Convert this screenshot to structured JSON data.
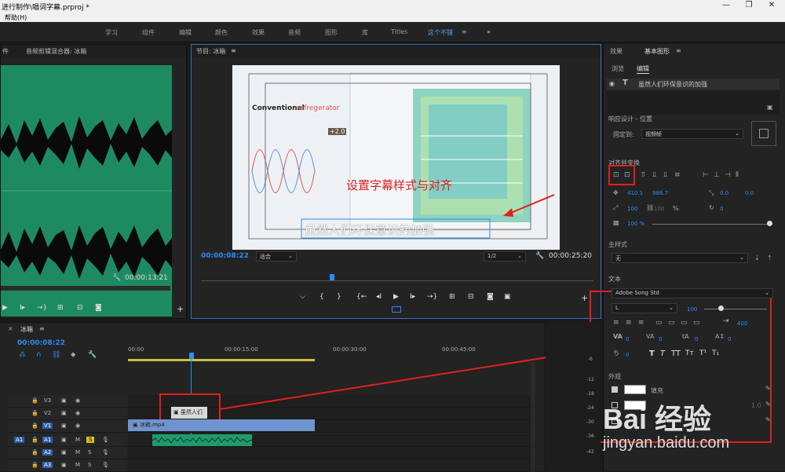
{
  "window": {
    "title": "进行制作\\唱词字幕.prproj *",
    "menu_help": "帮助(H)"
  },
  "workspaces": [
    {
      "label": "学习"
    },
    {
      "label": "组件"
    },
    {
      "label": "编辑"
    },
    {
      "label": "颜色"
    },
    {
      "label": "效果"
    },
    {
      "label": "音频"
    },
    {
      "label": "图形"
    },
    {
      "label": "库"
    },
    {
      "label": "Titles"
    },
    {
      "label": "这个不错"
    }
  ],
  "source_panel": {
    "tab_left": "件",
    "tab": "音频剪辑混合器: 冰箱",
    "timecode": "00:00:13:21"
  },
  "program": {
    "title": "节目: 冰箱",
    "timecode_current": "00:00:08:22",
    "timecode_duration": "00:00:25:20",
    "zoom": "适合",
    "resolution": "1/2",
    "video_heading_bold": "Conventional",
    "video_heading_light": "refregerator",
    "video_badge": "+2.0",
    "annotation": "设置字幕样式与对齐",
    "subtitle": "虽然人们环保意识的加强"
  },
  "right_panel": {
    "tab_effects": "效果",
    "tab_graphics": "基本图形",
    "subtab_browse": "浏览",
    "subtab_edit": "编辑",
    "layer_text": "虽然人们环保意识的加强",
    "responsive_label": "响应设计 - 位置",
    "pin_label": "固定到:",
    "pin_value": "视频帧",
    "align_label": "对齐并变换",
    "pos_x": "410.1",
    "pos_y": "988.7",
    "anchor_x": "0.0",
    "anchor_y": "0.0",
    "scale": "100",
    "scale2": "100",
    "scale_unit": "%",
    "rotation": "0",
    "opacity": "100 %",
    "master_style_label": "主样式",
    "master_style_value": "无",
    "text_label": "文本",
    "font_value": "Adobe Song Std",
    "font_style": "L",
    "font_size": "100",
    "tracking_right": "400",
    "kerning": "0",
    "tracking": "0",
    "leading": "0",
    "baseline": "0",
    "tsume": "0",
    "appearance_label": "外观",
    "fill_label": "填充",
    "stroke_value": "1.0"
  },
  "timeline": {
    "title": "冰箱",
    "timecode": "00:00:08:22",
    "ruler": [
      "00:00",
      "00:00:15:00",
      "00:00:30:00",
      "00:00:45:00"
    ],
    "tracks": [
      {
        "name": "V3"
      },
      {
        "name": "V2"
      },
      {
        "name": "V1"
      },
      {
        "name": "A1"
      },
      {
        "name": "A2"
      },
      {
        "name": "A3"
      }
    ],
    "clip_text": "虽然人们",
    "clip_video": "冰箱.mp4",
    "meter_labels": [
      "-6",
      "-12",
      "-18",
      "-24",
      "-30",
      "-36",
      "-42"
    ]
  },
  "watermark": {
    "brand": "Bai 经验",
    "url": "jingyan.baidu.com"
  },
  "colors": {
    "accent": "#2e8cf0",
    "waveform_bg": "#1e8a62",
    "highlight_red": "#e02020",
    "video_clip": "#6f94cf",
    "audio_clip": "#1f9a6e"
  }
}
